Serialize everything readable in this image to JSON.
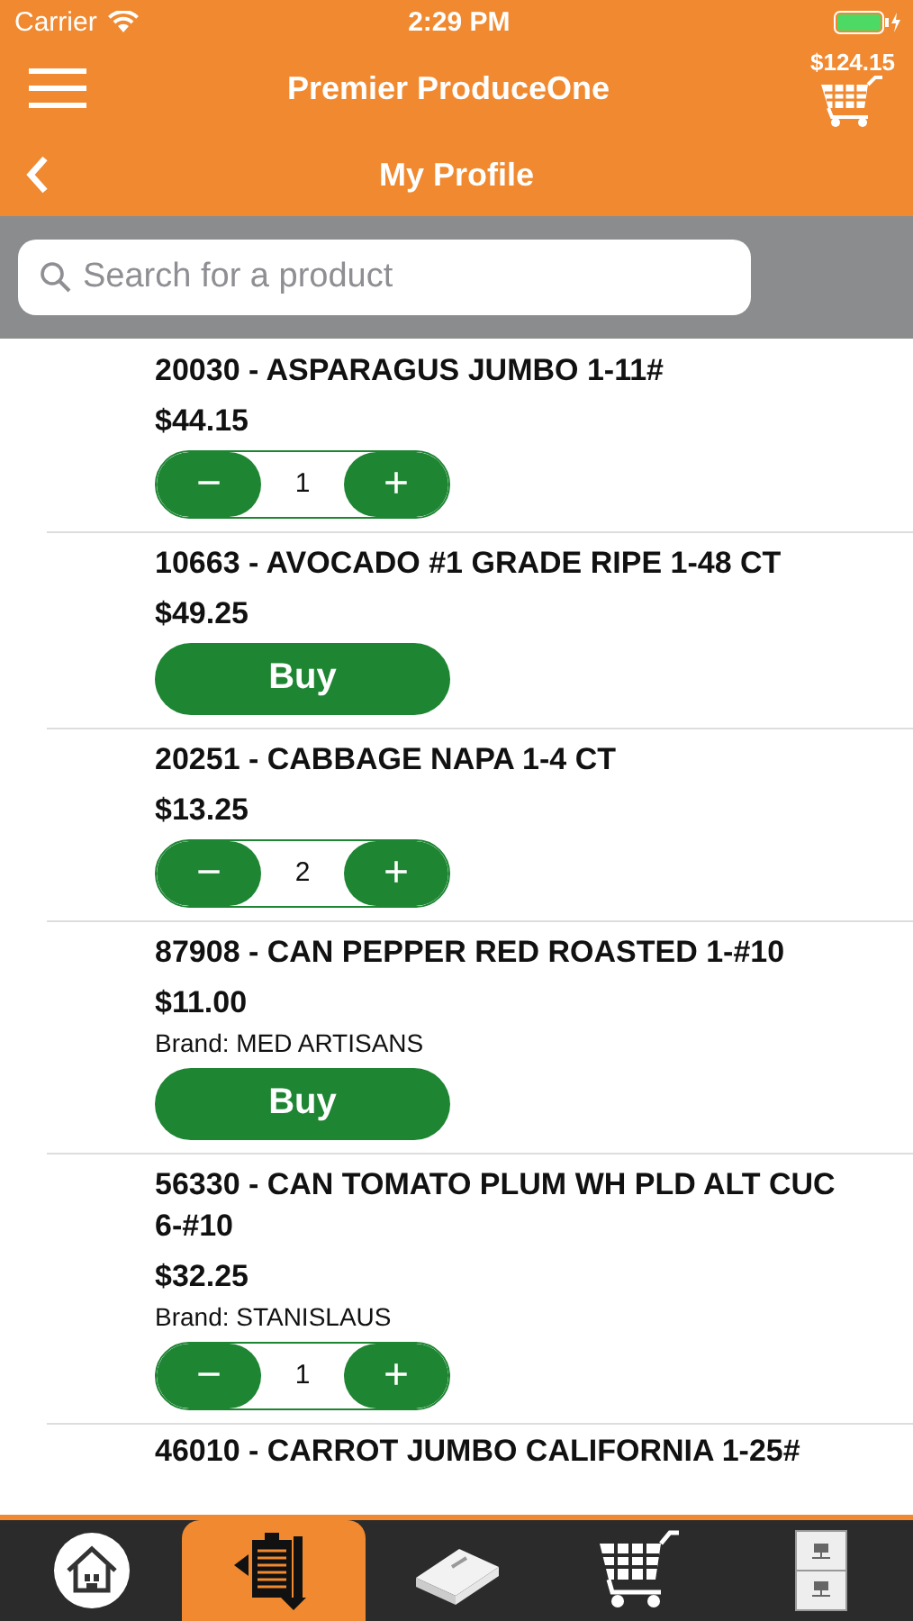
{
  "status_bar": {
    "carrier": "Carrier",
    "time": "2:29 PM"
  },
  "header": {
    "title": "Premier ProduceOne",
    "cart_total": "$124.15",
    "subtitle": "My Profile"
  },
  "search": {
    "placeholder": "Search for a product"
  },
  "products": [
    {
      "title": "20030 - ASPARAGUS JUMBO 1-11#",
      "price": "$44.15",
      "kind": "stepper",
      "minus": "−",
      "quantity": "1",
      "plus": "+"
    },
    {
      "title": "10663 - AVOCADO #1 GRADE RIPE 1-48 CT",
      "price": "$49.25",
      "kind": "buy",
      "button": "Buy"
    },
    {
      "title": "20251 - CABBAGE NAPA 1-4 CT",
      "price": "$13.25",
      "kind": "stepper",
      "minus": "−",
      "quantity": "2",
      "plus": "+"
    },
    {
      "title": "87908 - CAN PEPPER RED ROASTED 1-#10",
      "price": "$11.00",
      "brand": "Brand: MED ARTISANS",
      "kind": "buy",
      "button": "Buy"
    },
    {
      "title": "56330 - CAN TOMATO PLUM WH PLD ALT CUC 6-#10",
      "price": "$32.25",
      "brand": "Brand: STANISLAUS",
      "kind": "stepper",
      "minus": "−",
      "quantity": "1",
      "plus": "+"
    },
    {
      "title": "46010 - CARROT JUMBO CALIFORNIA 1-25#",
      "kind": "partial"
    }
  ],
  "tab_bar": [
    {
      "kind": "home",
      "selected": false
    },
    {
      "kind": "orders",
      "selected": true
    },
    {
      "kind": "catalog",
      "selected": false
    },
    {
      "kind": "cart",
      "selected": false
    },
    {
      "kind": "files",
      "selected": false
    }
  ]
}
